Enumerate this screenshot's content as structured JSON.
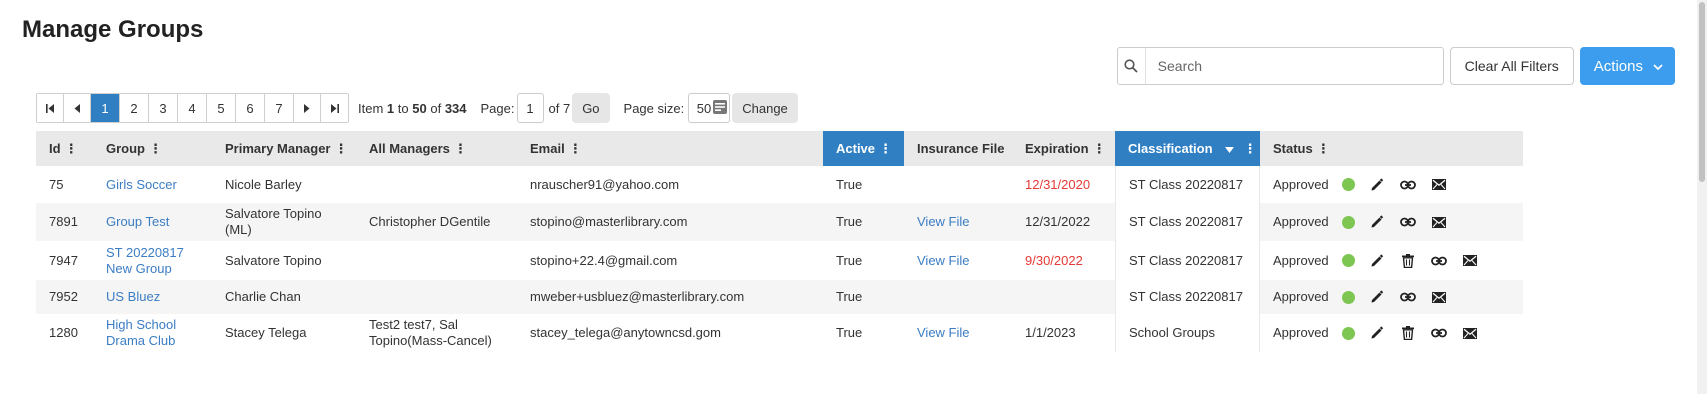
{
  "page": {
    "title": "Manage Groups"
  },
  "toolbar": {
    "search_placeholder": "Search",
    "clear_filters_label": "Clear All Filters",
    "actions_label": "Actions"
  },
  "pager": {
    "pages": [
      "1",
      "2",
      "3",
      "4",
      "5",
      "6",
      "7"
    ],
    "current_page": "1",
    "item_prefix": "Item",
    "item_from": "1",
    "item_to_word": "to",
    "item_to": "50",
    "item_of_word": "of",
    "item_total": "334",
    "page_label": "Page:",
    "page_value": "1",
    "page_of": "of 7",
    "go_label": "Go",
    "page_size_label": "Page size:",
    "page_size_value": "50",
    "change_label": "Change"
  },
  "table": {
    "columns": {
      "id": "Id",
      "group": "Group",
      "primary_manager": "Primary Manager",
      "all_managers": "All Managers",
      "email": "Email",
      "active": "Active",
      "insurance_file": "Insurance File",
      "expiration": "Expiration",
      "classification": "Classification",
      "status": "Status"
    },
    "rows": [
      {
        "id": "75",
        "group": "Girls Soccer",
        "primary_manager": "Nicole Barley",
        "all_managers": "",
        "email": "nrauscher91@yahoo.com",
        "active": "True",
        "insurance_file": "",
        "expiration": "12/31/2020",
        "expired": true,
        "classification": "ST Class 20220817",
        "status": "Approved",
        "has_delete": false
      },
      {
        "id": "7891",
        "group": "Group Test",
        "primary_manager": "Salvatore Topino (ML)",
        "all_managers": "Christopher DGentile",
        "email": "stopino@masterlibrary.com",
        "active": "True",
        "insurance_file": "View File",
        "expiration": "12/31/2022",
        "expired": false,
        "classification": "ST Class 20220817",
        "status": "Approved",
        "has_delete": false
      },
      {
        "id": "7947",
        "group": "ST 20220817 New Group",
        "primary_manager": "Salvatore Topino",
        "all_managers": "",
        "email": "stopino+22.4@gmail.com",
        "active": "True",
        "insurance_file": "View File",
        "expiration": "9/30/2022",
        "expired": true,
        "classification": "ST Class 20220817",
        "status": "Approved",
        "has_delete": true
      },
      {
        "id": "7952",
        "group": "US Bluez",
        "primary_manager": "Charlie Chan",
        "all_managers": "",
        "email": "mweber+usbluez@masterlibrary.com",
        "active": "True",
        "insurance_file": "",
        "expiration": "",
        "expired": false,
        "classification": "ST Class 20220817",
        "status": "Approved",
        "has_delete": false
      },
      {
        "id": "1280",
        "group": "High School Drama Club",
        "primary_manager": "Stacey Telega",
        "all_managers": "Test2 test7, Sal Topino(Mass-Cancel)",
        "email": "stacey_telega@anytowncsd.gom",
        "active": "True",
        "insurance_file": "View File",
        "expiration": "1/1/2023",
        "expired": false,
        "classification": "School Groups",
        "status": "Approved",
        "has_delete": true
      }
    ]
  },
  "icons": {
    "status": "green-dot-icon",
    "edit": "pencil-icon",
    "delete": "trash-icon",
    "link": "link-icon",
    "email": "envelope-icon"
  },
  "colors": {
    "accent": "#3c9cee",
    "selected_header": "#2f7fc2",
    "expired": "#e53935",
    "link": "#3b7dc4",
    "status_ok": "#7cc651"
  }
}
